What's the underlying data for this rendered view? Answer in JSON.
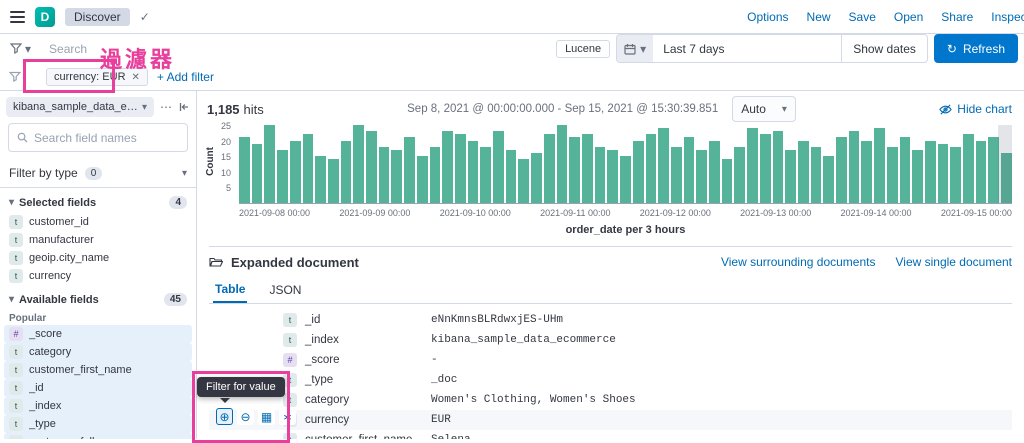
{
  "colors": {
    "annotation": "#E83E9C",
    "bar": "#54B399",
    "link": "#006BB4",
    "primary_button": "#0077CC"
  },
  "topbar": {
    "breadcrumb": "Discover",
    "nav": [
      "Options",
      "New",
      "Save",
      "Open",
      "Share",
      "Inspect"
    ]
  },
  "querybar": {
    "search_placeholder": "Search",
    "language_badge": "Lucene",
    "time_range": "Last 7 days",
    "show_dates_label": "Show dates",
    "refresh_label": "Refresh"
  },
  "filterbar": {
    "filter_pill": "currency: EUR",
    "add_filter_label": "+ Add filter",
    "annotation_text": "過濾器"
  },
  "sidebar": {
    "index_pattern": "kibana_sample_data_ecom...",
    "field_search_placeholder": "Search field names",
    "filter_by_type_label": "Filter by type",
    "filter_by_type_count": "0",
    "selected_fields_label": "Selected fields",
    "selected_fields_count": "4",
    "selected_fields": [
      {
        "type": "t",
        "name": "customer_id"
      },
      {
        "type": "t",
        "name": "manufacturer"
      },
      {
        "type": "t",
        "name": "geoip.city_name"
      },
      {
        "type": "t",
        "name": "currency"
      }
    ],
    "available_fields_label": "Available fields",
    "available_fields_count": "45",
    "popular_label": "Popular",
    "popular_fields": [
      {
        "type": "#",
        "name": "_score"
      },
      {
        "type": "t",
        "name": "category"
      },
      {
        "type": "t",
        "name": "customer_first_name"
      }
    ],
    "available_fields": [
      {
        "type": "t",
        "name": "_id"
      },
      {
        "type": "t",
        "name": "_index"
      },
      {
        "type": "t",
        "name": "_type"
      },
      {
        "type": "t",
        "name": "customer_full_name"
      }
    ]
  },
  "results": {
    "hits_count": "1,185",
    "hits_label": "hits",
    "date_range": "Sep 8, 2021 @ 00:00:00.000 - Sep 15, 2021 @ 15:30:39.851",
    "interval_value": "Auto",
    "hide_chart_label": "Hide chart"
  },
  "chart_data": {
    "type": "bar",
    "title": "",
    "xlabel": "order_date per 3 hours",
    "ylabel": "Count",
    "ylim": [
      0,
      25
    ],
    "yticks": [
      5,
      10,
      15,
      20,
      25
    ],
    "xticks": [
      "2021-09-08 00:00",
      "2021-09-09 00:00",
      "2021-09-10 00:00",
      "2021-09-11 00:00",
      "2021-09-12 00:00",
      "2021-09-13 00:00",
      "2021-09-14 00:00",
      "2021-09-15 00:00"
    ],
    "values": [
      21,
      19,
      25,
      17,
      20,
      22,
      15,
      14,
      20,
      25,
      23,
      18,
      17,
      21,
      15,
      18,
      23,
      22,
      20,
      18,
      23,
      17,
      14,
      16,
      22,
      25,
      21,
      22,
      18,
      17,
      15,
      20,
      22,
      24,
      18,
      21,
      17,
      20,
      14,
      18,
      24,
      22,
      23,
      17,
      20,
      18,
      15,
      21,
      23,
      20,
      24,
      18,
      21,
      17,
      20,
      19,
      18,
      22,
      20,
      21,
      16
    ]
  },
  "document": {
    "header_label": "Expanded document",
    "view_surrounding_label": "View surrounding documents",
    "view_single_label": "View single document",
    "tabs": [
      "Table",
      "JSON"
    ],
    "active_tab": "Table",
    "tooltip": "Filter for value",
    "action_icons": [
      "filter-for-value-icon",
      "filter-out-value-icon",
      "toggle-column-icon",
      "filter-exists-icon"
    ],
    "rows": [
      {
        "type": "t",
        "field": "_id",
        "value": "eNnKmnsBLRdwxjES-UHm"
      },
      {
        "type": "t",
        "field": "_index",
        "value": "kibana_sample_data_ecommerce"
      },
      {
        "type": "#",
        "field": "_score",
        "value": "-"
      },
      {
        "type": "t",
        "field": "_type",
        "value": "_doc"
      },
      {
        "type": "t",
        "field": "category",
        "value": "Women's Clothing, Women's Shoes"
      },
      {
        "type": "t",
        "field": "currency",
        "value": "EUR"
      },
      {
        "type": "t",
        "field": "customer_first_name",
        "value": "Selena"
      }
    ]
  }
}
